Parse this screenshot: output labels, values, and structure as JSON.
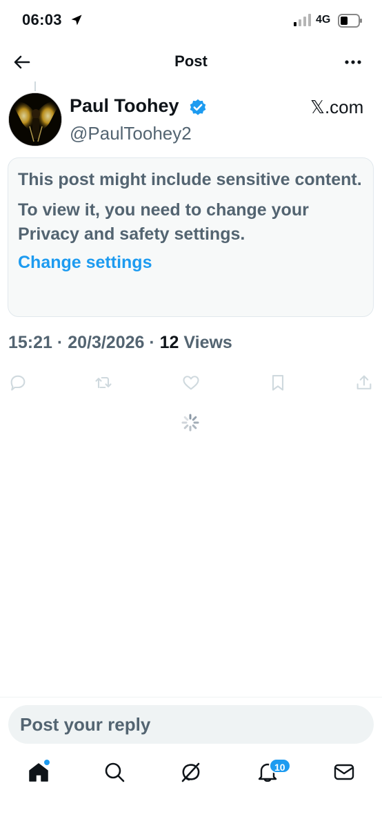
{
  "status_bar": {
    "time": "06:03",
    "network": "4G",
    "icons": [
      "location-arrow-icon",
      "signal-icon",
      "battery-icon"
    ]
  },
  "header": {
    "title": "Post",
    "back_icon": "back-arrow-icon",
    "more_icon": "more-dots-icon"
  },
  "post": {
    "author_name": "Paul Toohey",
    "author_handle": "@PaulToohey2",
    "verified_icon": "verified-badge-icon",
    "source": "𝕏.com",
    "sensitive_notice": {
      "title": "This post might include sensitive content.",
      "body": "To view it, you need to change your Privacy and safety settings.",
      "link": "Change settings"
    },
    "time": "15:21",
    "sep1": "·",
    "date": "20/3/2026",
    "sep2": "·",
    "views_count": "12",
    "views_label": "Views",
    "actions": [
      "reply-icon",
      "repost-icon",
      "like-icon",
      "bookmark-icon",
      "share-icon"
    ]
  },
  "reply": {
    "placeholder": "Post your reply"
  },
  "tab_bar": {
    "tabs": [
      "home-icon",
      "search-icon",
      "grok-icon",
      "notifications-icon",
      "messages-icon"
    ],
    "notification_count": "10"
  },
  "colors": {
    "accent": "#1d9bf0",
    "text_primary": "#0f1419",
    "text_secondary": "#536471",
    "card_bg": "#f7f9f9",
    "icon_muted": "#cfd9de"
  }
}
